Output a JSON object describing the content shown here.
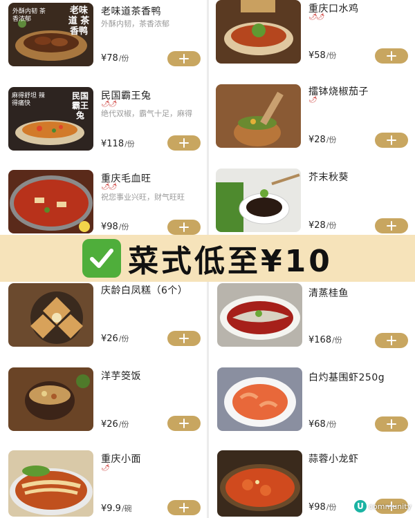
{
  "colors": {
    "accent": "#c8a660",
    "banner_bg": "#f6e3ba",
    "check_green": "#4fae3b",
    "chili_red": "#c9302c"
  },
  "icons": {
    "add": "plus-icon",
    "chili": "chili-pepper-icon",
    "check": "check-mark-icon"
  },
  "banner": {
    "text": "菜式低至¥10"
  },
  "watermark": {
    "badge": "U",
    "text": "community"
  },
  "left_items": [
    {
      "title": "老味道茶香鸭",
      "desc": "外酥内韧，茶香浓郁",
      "chili": "",
      "price": "¥78",
      "unit": "/份",
      "photo_text": "老味道 茶香鸭",
      "photo_sub": "外酥内韧 茶香浓郁"
    },
    {
      "title": "民国霸王兔",
      "desc": "绝代双椒，霸气十足，麻得...",
      "chili": "🌶🌶",
      "price": "¥118",
      "unit": "/份",
      "photo_text": "民国 霸王兔",
      "photo_sub": "麻得舒坦 辣得痛快"
    },
    {
      "title": "重庆毛血旺",
      "desc": "祝您事业兴旺，财气旺旺",
      "chili": "🌶🌶",
      "price": "¥98",
      "unit": "/份",
      "photo_text": "",
      "photo_sub": ""
    },
    {
      "title": "庆龄白凤糕（6个）",
      "desc": "",
      "chili": "",
      "price": "¥26",
      "unit": "/份",
      "photo_text": "",
      "photo_sub": ""
    },
    {
      "title": "洋芋筊饭",
      "desc": "",
      "chili": "",
      "price": "¥26",
      "unit": "/份",
      "photo_text": "",
      "photo_sub": ""
    },
    {
      "title": "重庆小面",
      "desc": "",
      "chili": "🌶",
      "price": "¥9.9",
      "unit": "/碗",
      "photo_text": "",
      "photo_sub": ""
    }
  ],
  "right_items": [
    {
      "title": "重庆口水鸡",
      "desc": "",
      "chili": "🌶🌶",
      "price": "¥58",
      "unit": "/份"
    },
    {
      "title": "擂钵烧椒茄子",
      "desc": "",
      "chili": "🌶",
      "price": "¥28",
      "unit": "/份"
    },
    {
      "title": "芥末秋葵",
      "desc": "",
      "chili": "",
      "price": "¥28",
      "unit": "/份"
    },
    {
      "title": "清蒸桂鱼",
      "desc": "",
      "chili": "",
      "price": "¥168",
      "unit": "/份"
    },
    {
      "title": "白灼基围虾250g",
      "desc": "",
      "chili": "",
      "price": "¥68",
      "unit": "/份"
    },
    {
      "title": "蒜蓉小龙虾",
      "desc": "",
      "chili": "",
      "price": "¥98",
      "unit": "/份"
    }
  ]
}
